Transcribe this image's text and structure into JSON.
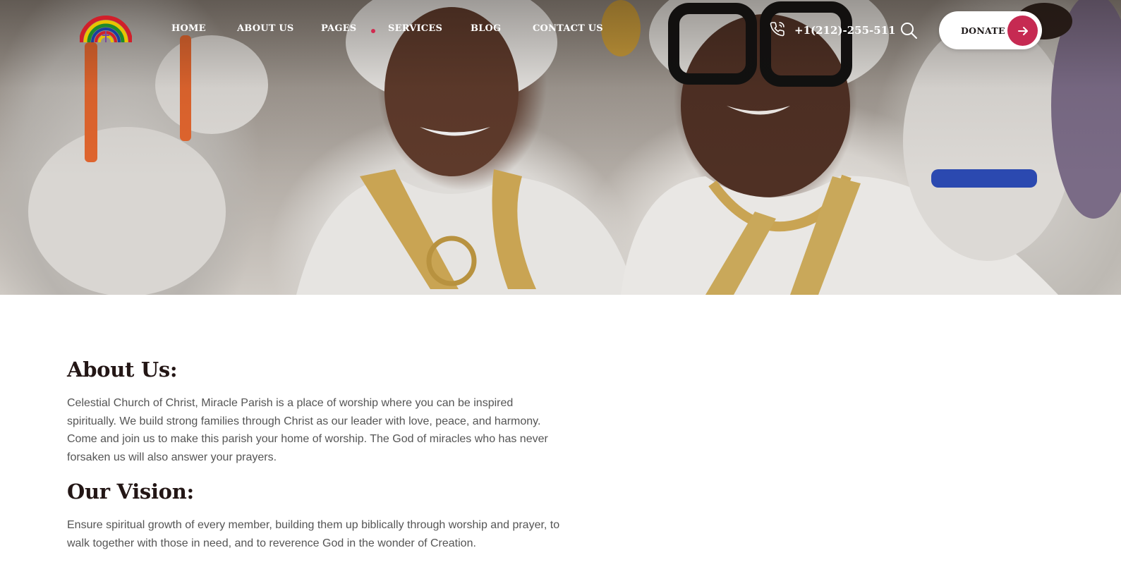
{
  "brand": {
    "logo_icon": "rainbow-church-logo-icon",
    "accent_color": "#c62a52",
    "heading_color": "#231615",
    "text_color": "#555555"
  },
  "nav": {
    "items": [
      {
        "label": "HOME"
      },
      {
        "label": "ABOUT US"
      },
      {
        "label": "PAGES"
      },
      {
        "label": "SERVICES"
      },
      {
        "label": "BLOG"
      },
      {
        "label": "CONTACT US"
      }
    ]
  },
  "header": {
    "phone_icon": "phone-icon",
    "phone": "+1(212)-255-511",
    "search_icon": "search-icon",
    "donate_label": "DONATE",
    "donate_icon": "arrow-right-icon"
  },
  "about": {
    "title": "About Us:",
    "text": "Celestial Church of Christ, Miracle Parish is a place of worship where you can be inspired spiritually. We build strong families through Christ as our leader with love, peace, and harmony. Come and join us to make this parish your home of worship. The God of miracles who has never forsaken us will also answer your prayers."
  },
  "vision": {
    "title": "Our Vision:",
    "text": "Ensure spiritual growth of every member, building them up biblically through worship and prayer, to walk together with those in need, and to reverence God in the wonder of Creation."
  }
}
